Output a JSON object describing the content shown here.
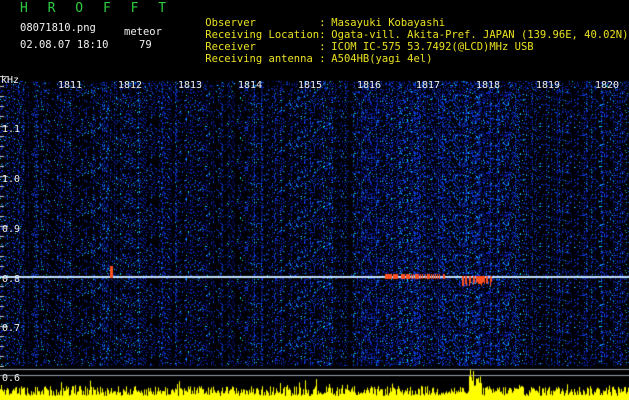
{
  "header": {
    "brand": "H R O F F T",
    "filename": "08071810.png",
    "datetime": "02.08.07 18:10",
    "meteor_label": "meteor",
    "meteor_count": "79",
    "info": [
      {
        "key": "Observer",
        "value": "Masayuki Kobayashi"
      },
      {
        "key": "Receiving Location",
        "value": "Ogata-vill. Akita-Pref. JAPAN (139.96E, 40.02N)"
      },
      {
        "key": "Receiver",
        "value": "ICOM IC-575 53.7492(@LCD)MHz USB"
      },
      {
        "key": "Receiving antenna",
        "value": "A504HB(yagi 4el)"
      }
    ]
  },
  "axes": {
    "y_unit": "kHz",
    "y_ticks": [
      "1.1",
      "1.0",
      "0.9",
      "0.8",
      "0.7",
      "0.6"
    ],
    "x_ticks": [
      "1811",
      "1812",
      "1813",
      "1814",
      "1815",
      "1816",
      "1817",
      "1818",
      "1819",
      "1820"
    ]
  },
  "colors": {
    "background": "#000000",
    "spectrum_blue": "#1a3cff",
    "carrier": "#ff6020",
    "activity_bars": "#ffff00",
    "brand": "#2ecc40",
    "info_text": "#e8e020"
  }
}
